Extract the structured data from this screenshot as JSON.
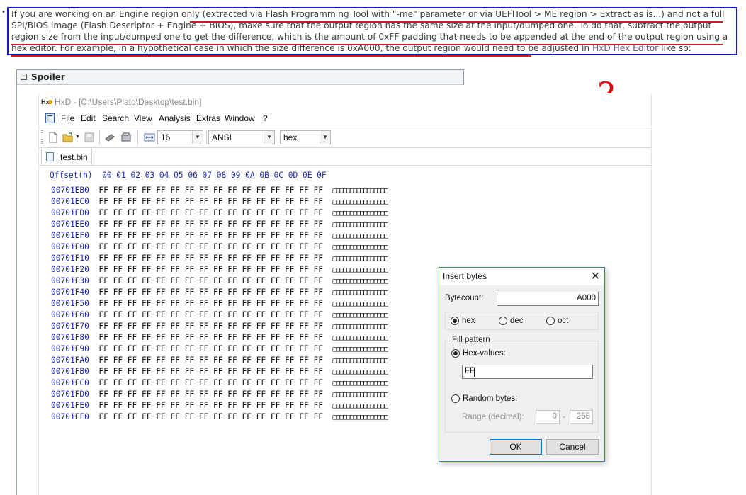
{
  "post": {
    "text_segments": [
      {
        "t": "If you are working on an Engine region only (extracted via Flash Programming Tool with \"-me\" parameter or via UEFITool > ME region > Extract as is...) and not a full SPI/BIOS image (Flash Descriptor + Engine + BIOS), make sure that the output region has the same size at the input/dumped one. To do that, subtract the output region size from the input/dumped one to get the difference, which is the amount of 0xFF padding that needs to be appended at the end of the output region using a hex editor. For example, in a hypothetical case in which the size difference is 0xA000, the output region would need to be adjusted in "
      },
      {
        "t": "HxD Hex Editor",
        "link": true
      },
      {
        "t": " like so:"
      }
    ]
  },
  "spoiler": {
    "toggle": "−",
    "title": "Spoiler"
  },
  "annotation": {
    "mark": "?",
    "color": "#e01010"
  },
  "hxd": {
    "title": "HxD - [C:\\Users\\Plato\\Desktop\\test.bin]",
    "menu": [
      "File",
      "Edit",
      "Search",
      "View",
      "Analysis",
      "Extras",
      "Window",
      "?"
    ],
    "toolbar": {
      "bytes_per_row": "16",
      "charset": "ANSI",
      "mode": "hex"
    },
    "tab": "test.bin",
    "header": "Offset(h)  00 01 02 03 04 05 06 07 08 09 0A 0B 0C 0D 0E 0F",
    "rows": [
      {
        "off": "00701EB0",
        "bytes": "FF FF FF FF FF FF FF FF FF FF FF FF FF FF FF FF",
        "txt": "□□□□□□□□□□□□□□□□"
      },
      {
        "off": "00701EC0",
        "bytes": "FF FF FF FF FF FF FF FF FF FF FF FF FF FF FF FF",
        "txt": "□□□□□□□□□□□□□□□□"
      },
      {
        "off": "00701ED0",
        "bytes": "FF FF FF FF FF FF FF FF FF FF FF FF FF FF FF FF",
        "txt": "□□□□□□□□□□□□□□□□"
      },
      {
        "off": "00701EE0",
        "bytes": "FF FF FF FF FF FF FF FF FF FF FF FF FF FF FF FF",
        "txt": "□□□□□□□□□□□□□□□□"
      },
      {
        "off": "00701EF0",
        "bytes": "FF FF FF FF FF FF FF FF FF FF FF FF FF FF FF FF",
        "txt": "□□□□□□□□□□□□□□□□"
      },
      {
        "off": "00701F00",
        "bytes": "FF FF FF FF FF FF FF FF FF FF FF FF FF FF FF FF",
        "txt": "□□□□□□□□□□□□□□□□"
      },
      {
        "off": "00701F10",
        "bytes": "FF FF FF FF FF FF FF FF FF FF FF FF FF FF FF FF",
        "txt": "□□□□□□□□□□□□□□□□"
      },
      {
        "off": "00701F20",
        "bytes": "FF FF FF FF FF FF FF FF FF FF FF FF FF FF FF FF",
        "txt": "□□□□□□□□□□□□□□□□"
      },
      {
        "off": "00701F30",
        "bytes": "FF FF FF FF FF FF FF FF FF FF FF FF FF FF FF FF",
        "txt": "□□□□□□□□□□□□□□□□"
      },
      {
        "off": "00701F40",
        "bytes": "FF FF FF FF FF FF FF FF FF FF FF FF FF FF FF FF",
        "txt": "□□□□□□□□□□□□□□□□"
      },
      {
        "off": "00701F50",
        "bytes": "FF FF FF FF FF FF FF FF FF FF FF FF FF FF FF FF",
        "txt": "□□□□□□□□□□□□□□□□"
      },
      {
        "off": "00701F60",
        "bytes": "FF FF FF FF FF FF FF FF FF FF FF FF FF FF FF FF",
        "txt": "□□□□□□□□□□□□□□□□"
      },
      {
        "off": "00701F70",
        "bytes": "FF FF FF FF FF FF FF FF FF FF FF FF FF FF FF FF",
        "txt": "□□□□□□□□□□□□□□□□"
      },
      {
        "off": "00701F80",
        "bytes": "FF FF FF FF FF FF FF FF FF FF FF FF FF FF FF FF",
        "txt": "□□□□□□□□□□□□□□□□"
      },
      {
        "off": "00701F90",
        "bytes": "FF FF FF FF FF FF FF FF FF FF FF FF FF FF FF FF",
        "txt": "□□□□□□□□□□□□□□□□"
      },
      {
        "off": "00701FA0",
        "bytes": "FF FF FF FF FF FF FF FF FF FF FF FF FF FF FF FF",
        "txt": "□□□□□□□□□□□□□□□□"
      },
      {
        "off": "00701FB0",
        "bytes": "FF FF FF FF FF FF FF FF FF FF FF FF FF FF FF FF",
        "txt": "□□□□□□□□□□□□□□□□"
      },
      {
        "off": "00701FC0",
        "bytes": "FF FF FF FF FF FF FF FF FF FF FF FF FF FF FF FF",
        "txt": "□□□□□□□□□□□□□□□□"
      },
      {
        "off": "00701FD0",
        "bytes": "FF FF FF FF FF FF FF FF FF FF FF FF FF FF FF FF",
        "txt": "□□□□□□□□□□□□□□□□"
      },
      {
        "off": "00701FE0",
        "bytes": "FF FF FF FF FF FF FF FF FF FF FF FF FF FF FF FF",
        "txt": "□□□□□□□□□□□□□□□□"
      },
      {
        "off": "00701FF0",
        "bytes": "FF FF FF FF FF FF FF FF FF FF FF FF FF FF FF FF",
        "txt": "□□□□□□□□□□□□□□□□"
      }
    ]
  },
  "dialog": {
    "title": "Insert bytes",
    "bytecount_label": "Bytecount:",
    "bytecount_value": "A000",
    "radix": {
      "hex": "hex",
      "dec": "dec",
      "oct": "oct",
      "selected": "hex"
    },
    "fill_pattern": {
      "title": "Fill pattern",
      "hex_values_label": "Hex-values:",
      "hex_values": "FF",
      "random_label": "Random bytes:",
      "range_label": "Range (decimal):",
      "range_from": "0",
      "range_sep": "-",
      "range_to": "255",
      "selected": "hex-values"
    },
    "ok": "OK",
    "cancel": "Cancel"
  }
}
